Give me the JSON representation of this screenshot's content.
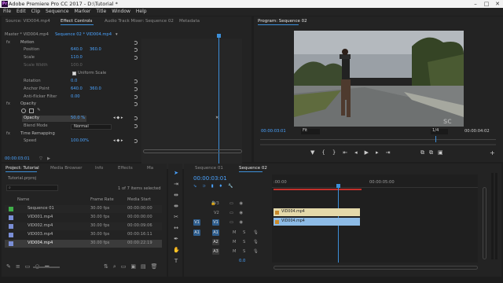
{
  "window": {
    "title": "Adobe Premiere Pro CC 2017 - D:\\Tutorial *",
    "icon_text": "Pr",
    "controls": [
      "–",
      "□",
      "✕"
    ]
  },
  "menu": [
    "File",
    "Edit",
    "Clip",
    "Sequence",
    "Marker",
    "Title",
    "Window",
    "Help"
  ],
  "source_tabs": [
    "Source: VID004.mp4",
    "Effect Controls",
    "Audio Track Mixer: Sequence 02",
    "Metadata"
  ],
  "effect_controls": {
    "master": "Master * VID004.mp4",
    "sequence": "Sequence 02 * VID004.mp4",
    "sections": [
      {
        "label": "fx",
        "name": "Motion"
      },
      {
        "label": "",
        "name": "Position",
        "v1": "640.0",
        "v2": "360.0"
      },
      {
        "label": "",
        "name": "Scale",
        "v1": "110.0"
      },
      {
        "label": "",
        "name": "Scale Width",
        "v1": "100.0"
      },
      {
        "label": "",
        "name": "Uniform Scale"
      },
      {
        "label": "",
        "name": "Rotation",
        "v1": "0.0"
      },
      {
        "label": "",
        "name": "Anchor Point",
        "v1": "640.0",
        "v2": "360.0"
      },
      {
        "label": "",
        "name": "Anti-flicker Filter",
        "v1": "0.00"
      },
      {
        "label": "fx",
        "name": "Opacity"
      },
      {
        "label": "",
        "name": "Opacity",
        "v1": "50.0 %"
      },
      {
        "label": "",
        "name": "Blend Mode",
        "v1": "Normal"
      },
      {
        "label": "fx",
        "name": "Time Remapping"
      },
      {
        "label": "",
        "name": "Speed",
        "v1": "100.00%"
      }
    ],
    "timecode": "00:00:03:01"
  },
  "program": {
    "tab": "Program: Sequence 02",
    "timecode": "00:00:03:01",
    "fit": "Fit",
    "zoom": "1/4",
    "duration": "00:00:04:02",
    "watermark": "sc"
  },
  "project": {
    "tabs": [
      "Project: Tutorial",
      "Media Browser",
      "Info",
      "Effects",
      "Ma"
    ],
    "file": "Tutorial.prproj",
    "count": "1 of 7 items selected",
    "headers": [
      "Name",
      "Frame Rate",
      "Media Start"
    ],
    "rows": [
      {
        "name": "Sequence 01",
        "fps": "30.00 fps",
        "start": "00:00:00:00",
        "color": "#3fae49"
      },
      {
        "name": "VID001.mp4",
        "fps": "30.00 fps",
        "start": "00:00:00:00",
        "color": "#7a8ed6"
      },
      {
        "name": "VID002.mp4",
        "fps": "30.00 fps",
        "start": "00:00:09:06",
        "color": "#7a8ed6"
      },
      {
        "name": "VID003.mp4",
        "fps": "30.00 fps",
        "start": "00:00:16:11",
        "color": "#7a8ed6"
      },
      {
        "name": "VID004.mp4",
        "fps": "30.00 fps",
        "start": "00:00:22:19",
        "color": "#7a8ed6"
      }
    ]
  },
  "timeline": {
    "tabs": [
      "Sequence 01",
      "Sequence 02"
    ],
    "timecode": "00:00:03:01",
    "ruler": [
      ":00:00",
      "00:00:05:00"
    ],
    "video_tracks": [
      "V3",
      "V2",
      "V1"
    ],
    "audio_tracks": [
      "A1",
      "A2",
      "A3"
    ],
    "source_patch_v": "V1",
    "source_patch_a": "A1",
    "clip_v": "VID004.mp4",
    "clip_a": "VID004.mp4",
    "master_val": "0.0",
    "audio_btns": [
      "M",
      "S"
    ]
  }
}
